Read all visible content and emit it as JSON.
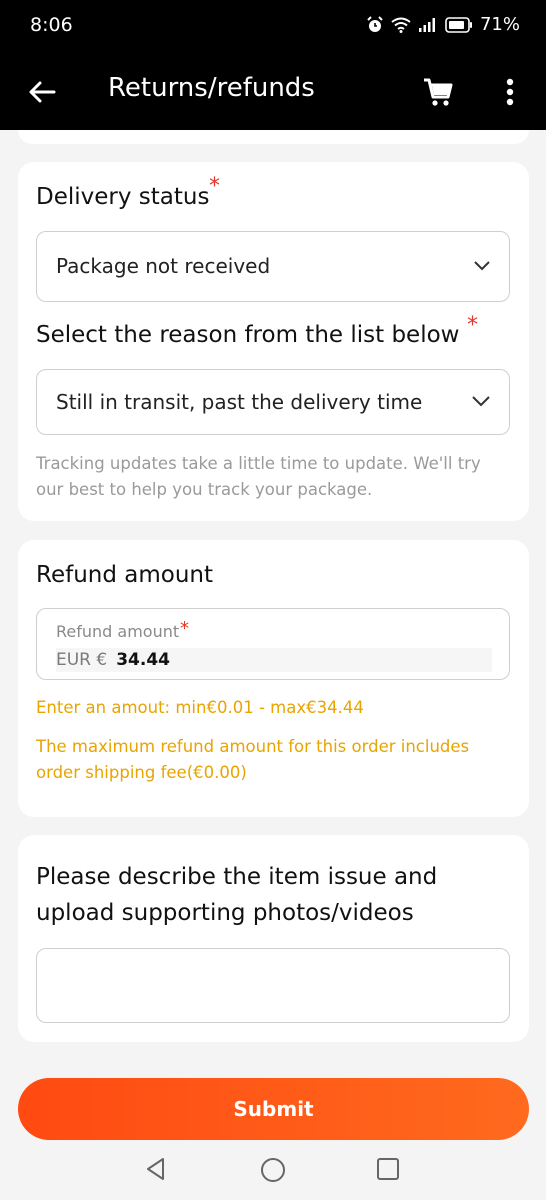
{
  "status_bar": {
    "time": "8:06",
    "battery": "71%"
  },
  "app_bar": {
    "title": "Returns/refunds"
  },
  "delivery": {
    "title": "Delivery status",
    "selected": "Package not received",
    "reason_title": "Select the reason from the list below",
    "reason_selected": "Still in transit, past the delivery time",
    "hint": "Tracking updates take a little time to update. We'll try our best to help you track your package."
  },
  "refund": {
    "title": "Refund amount",
    "field_label": "Refund amount",
    "currency": "EUR €",
    "value": "34.44",
    "range_note": "Enter an amout: min€0.01 - max€34.44",
    "shipping_note": "The maximum refund amount for this order includes order shipping fee(€0.00)"
  },
  "describe": {
    "title": "Please describe the item issue and upload supporting photos/videos",
    "input_value": ""
  },
  "submit_label": "Submit",
  "required_mark": "*",
  "colors": {
    "accent": "#ff5a16",
    "required": "#e0362c",
    "warning": "#e8a400"
  }
}
